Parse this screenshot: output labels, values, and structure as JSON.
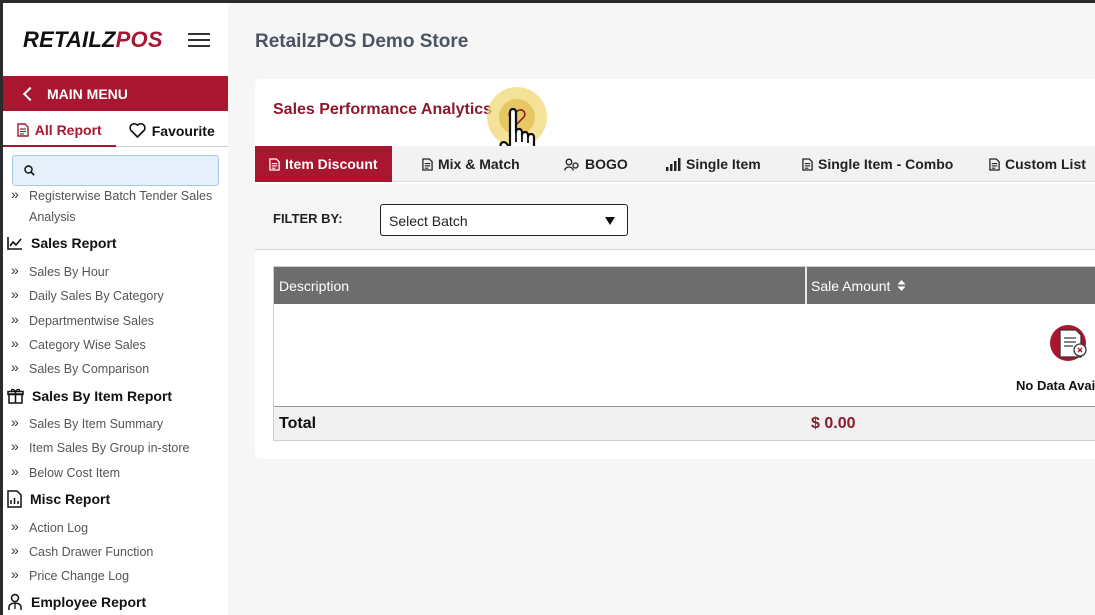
{
  "sidebar": {
    "logo": {
      "part1": "RETAILZ",
      "part2": "POS"
    },
    "main_menu_label": "MAIN MENU",
    "tabs": {
      "all_report": "All Report",
      "favourite": "Favourite"
    },
    "search": {
      "placeholder": ""
    },
    "items": [
      {
        "type": "item",
        "label": "Registerwise Batch Tender Sales Analysis"
      },
      {
        "type": "section",
        "label": "Sales Report",
        "icon": "line-chart-icon"
      },
      {
        "type": "item",
        "label": "Sales By Hour"
      },
      {
        "type": "item",
        "label": "Daily Sales By Category"
      },
      {
        "type": "item",
        "label": "Departmentwise Sales"
      },
      {
        "type": "item",
        "label": "Category Wise Sales"
      },
      {
        "type": "item",
        "label": "Sales By Comparison"
      },
      {
        "type": "section",
        "label": "Sales By Item Report",
        "icon": "gift-box-icon"
      },
      {
        "type": "item",
        "label": "Sales By Item Summary"
      },
      {
        "type": "item",
        "label": "Item Sales By Group in-store"
      },
      {
        "type": "item",
        "label": "Below Cost Item"
      },
      {
        "type": "section",
        "label": "Misc Report",
        "icon": "document-chart-icon"
      },
      {
        "type": "item",
        "label": "Action Log"
      },
      {
        "type": "item",
        "label": "Cash Drawer Function"
      },
      {
        "type": "item",
        "label": "Price Change Log"
      },
      {
        "type": "section",
        "label": "Employee Report",
        "icon": "employee-icon"
      }
    ]
  },
  "header": {
    "store_title": "RetailzPOS Demo Store"
  },
  "card": {
    "title": "Sales Performance Analytics",
    "tabs": [
      {
        "label": "Item Discount",
        "icon": "document-icon",
        "active": true
      },
      {
        "label": "Mix & Match",
        "icon": "document-icon",
        "active": false
      },
      {
        "label": "BOGO",
        "icon": "users-icon",
        "active": false
      },
      {
        "label": "Single Item",
        "icon": "bar-chart-icon",
        "active": false
      },
      {
        "label": "Single Item - Combo",
        "icon": "document-icon",
        "active": false
      },
      {
        "label": "Custom List",
        "icon": "document-icon",
        "active": false
      }
    ],
    "filter": {
      "label": "FILTER BY:",
      "select_value": "Select Batch"
    },
    "table": {
      "columns": [
        "Description",
        "Sale Amount"
      ],
      "no_data_text": "No Data Avai",
      "total_label": "Total",
      "total_value": "$ 0.00"
    }
  },
  "colors": {
    "brand": "#a8172f",
    "title": "#8c1a2c",
    "header_gray": "#6d6d6d"
  }
}
